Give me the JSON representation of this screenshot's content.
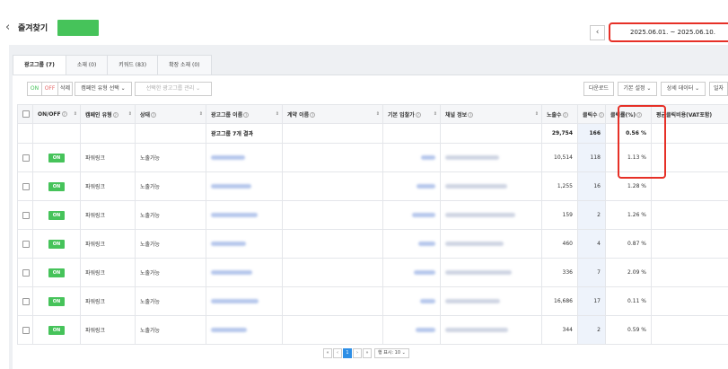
{
  "header": {
    "back_icon": "chevron-left-icon",
    "title": "즐겨찾기",
    "badge_color": "#46c35a",
    "date_prev": "‹",
    "date_range": "2025.06.01. ~ 2025.06.10."
  },
  "tabs": [
    {
      "label": "광고그룹 (7)",
      "active": true
    },
    {
      "label": "소재 (0)",
      "active": false
    },
    {
      "label": "키워드 (83)",
      "active": false
    },
    {
      "label": "확장 소재 (0)",
      "active": false
    }
  ],
  "toolbar": {
    "on": "ON",
    "off": "OFF",
    "delete": "삭제",
    "campaign_type_select": "캠페인 유형 선택 ⌄",
    "manage_selected": "선택한 광고그룹 관리 ⌄",
    "download": "다운로드",
    "default_settings": "기본 설정 ⌄",
    "detail_data": "상세 데이터 ⌄",
    "more": "일자"
  },
  "table": {
    "headers": {
      "onoff": "ON/OFF",
      "campaign_type": "캠페인 유형",
      "status": "상태",
      "adgroup_name": "광고그룹 이름",
      "account_name": "계약 이름",
      "base_bid": "기본 입찰가",
      "channel_info": "채널 정보",
      "impressions": "노출수",
      "clicks": "클릭수",
      "ctr": "클릭률(%)",
      "avg_cpc": "평균클릭비용(VAT포함)"
    },
    "summary": {
      "label": "광고그룹 7개 결과",
      "impressions": "29,754",
      "clicks": "166",
      "ctr": "0.56 %"
    },
    "rows": [
      {
        "onoff": "ON",
        "campaign_type": "파워링크",
        "status": "노출가능",
        "impressions": "10,514",
        "clicks": "118",
        "ctr": "1.13 %"
      },
      {
        "onoff": "ON",
        "campaign_type": "파워링크",
        "status": "노출가능",
        "impressions": "1,255",
        "clicks": "16",
        "ctr": "1.28 %"
      },
      {
        "onoff": "ON",
        "campaign_type": "파워링크",
        "status": "노출가능",
        "impressions": "159",
        "clicks": "2",
        "ctr": "1.26 %"
      },
      {
        "onoff": "ON",
        "campaign_type": "파워링크",
        "status": "노출가능",
        "impressions": "460",
        "clicks": "4",
        "ctr": "0.87 %"
      },
      {
        "onoff": "ON",
        "campaign_type": "파워링크",
        "status": "노출가능",
        "impressions": "336",
        "clicks": "7",
        "ctr": "2.09 %"
      },
      {
        "onoff": "ON",
        "campaign_type": "파워링크",
        "status": "노출가능",
        "impressions": "16,686",
        "clicks": "17",
        "ctr": "0.11 %"
      },
      {
        "onoff": "ON",
        "campaign_type": "파워링크",
        "status": "노출가능",
        "impressions": "344",
        "clicks": "2",
        "ctr": "0.59 %"
      }
    ]
  },
  "pagination": {
    "first": "«",
    "prev": "‹",
    "current": "1",
    "next": "›",
    "last": "»",
    "per_page": "행 표시: 10 ⌄"
  },
  "colors": {
    "accent_green": "#46c35a",
    "highlight_red": "#e63027",
    "page_blue": "#2e8fe6"
  }
}
